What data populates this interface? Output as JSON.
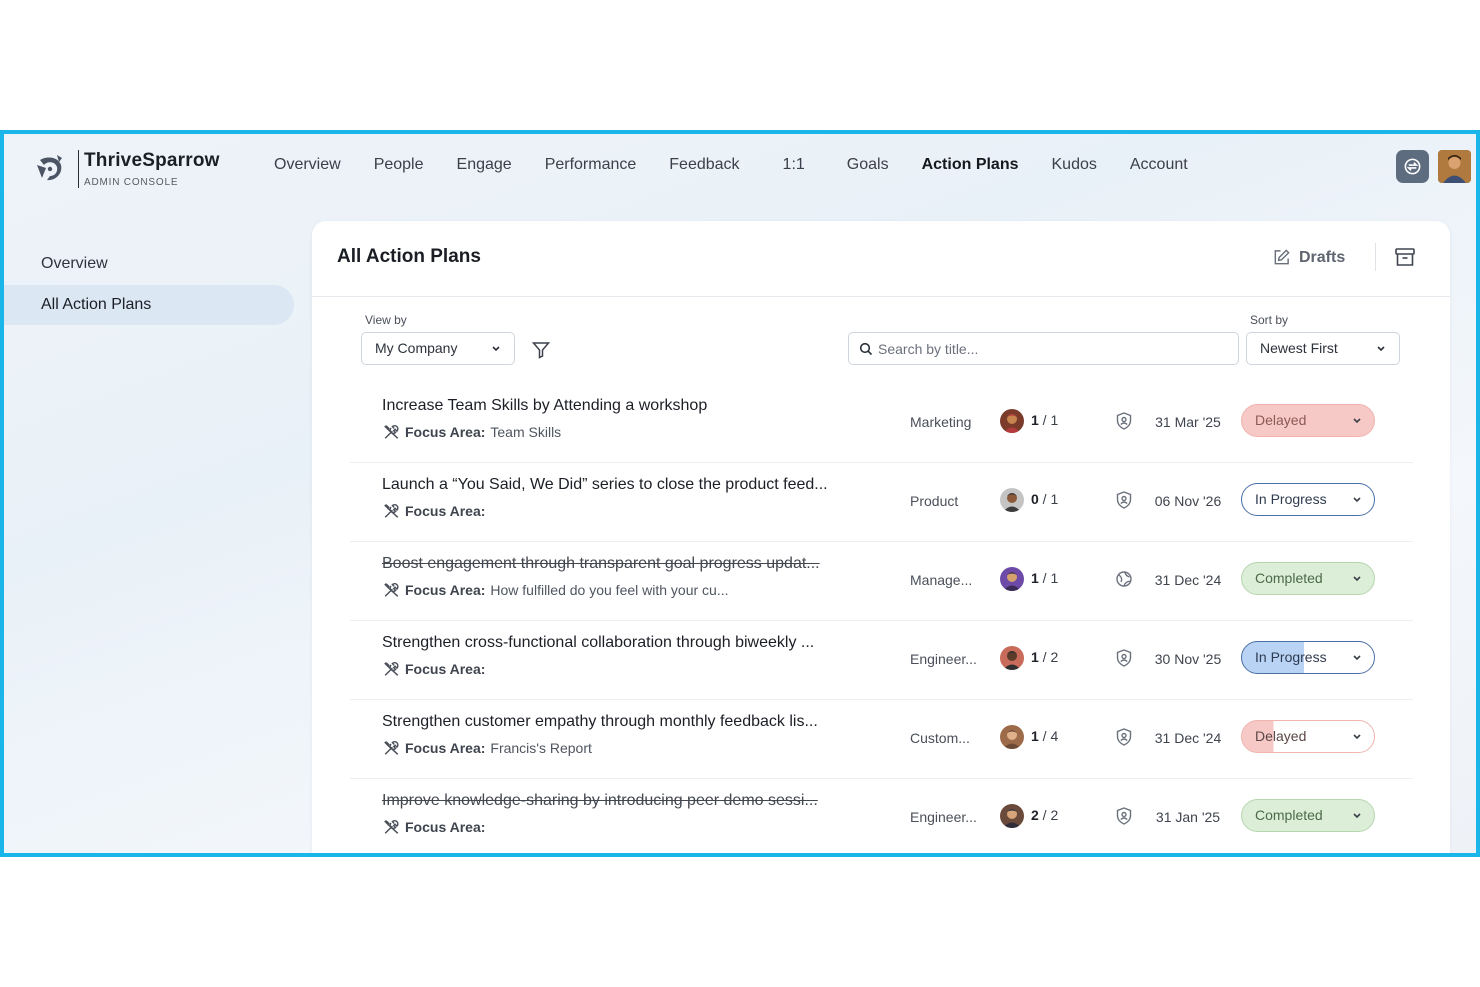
{
  "app": {
    "brand_name": "ThriveSparrow",
    "brand_sub": "ADMIN CONSOLE",
    "accent_color": "#1ab6ea"
  },
  "nav": {
    "items": [
      "Overview",
      "People",
      "Engage",
      "Performance",
      "Feedback",
      "1:1",
      "Goals",
      "Action Plans",
      "Kudos",
      "Account"
    ],
    "active": "Action Plans"
  },
  "sidebar": {
    "items": [
      {
        "label": "Overview",
        "active": false
      },
      {
        "label": "All Action Plans",
        "active": true
      }
    ]
  },
  "main": {
    "title": "All Action Plans",
    "drafts_label": "Drafts",
    "view_by_label": "View by",
    "view_by_value": "My Company",
    "sort_by_label": "Sort by",
    "sort_by_value": "Newest First",
    "search_placeholder": "Search by title..."
  },
  "rows": [
    {
      "title": "Increase Team Skills by Attending a workshop",
      "completed": false,
      "focus_label": "Focus Area:",
      "focus_value": "Team Skills",
      "department": "Marketing",
      "done": "1",
      "total": "1",
      "visibility_icon": "shield-user-icon",
      "due_date": "31 Mar '25",
      "status": "Delayed"
    },
    {
      "title": "Launch a “You Said, We Did” series to close the product feed...",
      "completed": false,
      "focus_label": "Focus Area:",
      "focus_value": "",
      "department": "Product",
      "done": "0",
      "total": "1",
      "visibility_icon": "shield-user-icon",
      "due_date": "06 Nov '26",
      "status": "In Progress"
    },
    {
      "title": "Boost engagement through transparent goal progress updat...",
      "completed": true,
      "focus_label": "Focus Area:",
      "focus_value": "How fulfilled do you feel with your cu...",
      "department": "Manage...",
      "done": "1",
      "total": "1",
      "visibility_icon": "globe-icon",
      "due_date": "31 Dec '24",
      "status": "Completed"
    },
    {
      "title": "Strengthen cross-functional collaboration through biweekly ...",
      "completed": false,
      "focus_label": "Focus Area:",
      "focus_value": "",
      "department": "Engineer...",
      "done": "1",
      "total": "2",
      "visibility_icon": "shield-user-icon",
      "due_date": "30 Nov '25",
      "status": "In Progress"
    },
    {
      "title": "Strengthen customer empathy through monthly feedback lis...",
      "completed": false,
      "focus_label": "Focus Area:",
      "focus_value": "Francis's Report",
      "department": "Custom...",
      "done": "1",
      "total": "4",
      "visibility_icon": "shield-user-icon",
      "due_date": "31 Dec '24",
      "status": "Delayed"
    },
    {
      "title": "Improve knowledge-sharing by introducing peer demo sessi...",
      "completed": true,
      "focus_label": "Focus Area:",
      "focus_value": "",
      "department": "Engineer...",
      "done": "2",
      "total": "2",
      "visibility_icon": "shield-user-icon",
      "due_date": "31 Jan '25",
      "status": "Completed"
    }
  ],
  "status_colors": {
    "Delayed": "#f6c9c6",
    "In Progress": "#b9d3f4",
    "Completed": "#dcedd8"
  }
}
